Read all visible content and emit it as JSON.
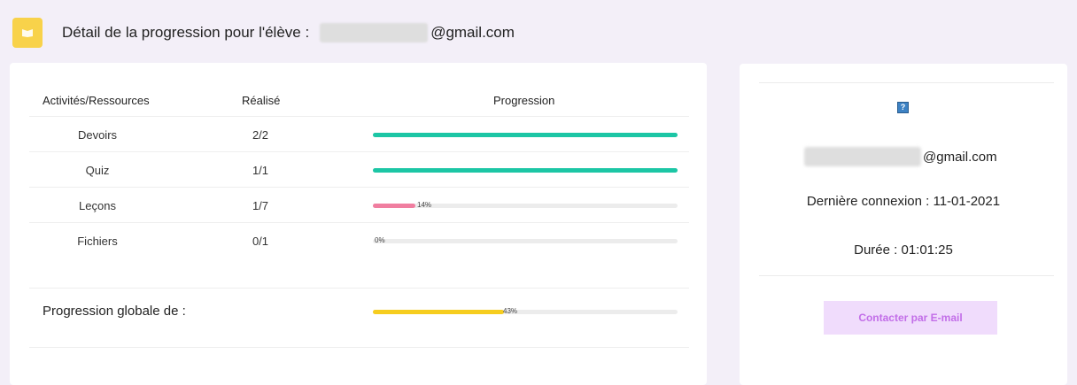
{
  "header": {
    "title_prefix": "Détail de la progression pour l'élève :",
    "email_suffix": "@gmail.com"
  },
  "table": {
    "columns": [
      "Activités/Ressources",
      "Réalisé",
      "Progression"
    ],
    "rows": [
      {
        "name": "Devoirs",
        "done": "2/2",
        "progress": 1.0,
        "label": "",
        "color": "#1cc6a5"
      },
      {
        "name": "Quiz",
        "done": "1/1",
        "progress": 1.0,
        "label": "",
        "color": "#1cc6a5"
      },
      {
        "name": "Leçons",
        "done": "1/7",
        "progress": 0.14,
        "label": "14%",
        "color": "#f07ea0"
      },
      {
        "name": "Fichiers",
        "done": "0/1",
        "progress": 0.0,
        "label": "0%",
        "color": "#cccccc"
      }
    ],
    "global": {
      "label": "Progression globale de :",
      "progress": 0.43,
      "percent": "43%",
      "color": "#f6cd1f"
    }
  },
  "profile": {
    "help_icon": "?",
    "email_suffix": "@gmail.com",
    "last_login": "Dernière connexion : 11-01-2021",
    "duration": "Durée : 01:01:25",
    "contact_label": "Contacter par E-mail"
  },
  "colors": {
    "background": "#f3eff8",
    "accent_yellow": "#f8d24a",
    "button_bg": "#f0dcfc",
    "button_text": "#c26ee8"
  },
  "icons": [
    "book-icon",
    "help-icon"
  ]
}
